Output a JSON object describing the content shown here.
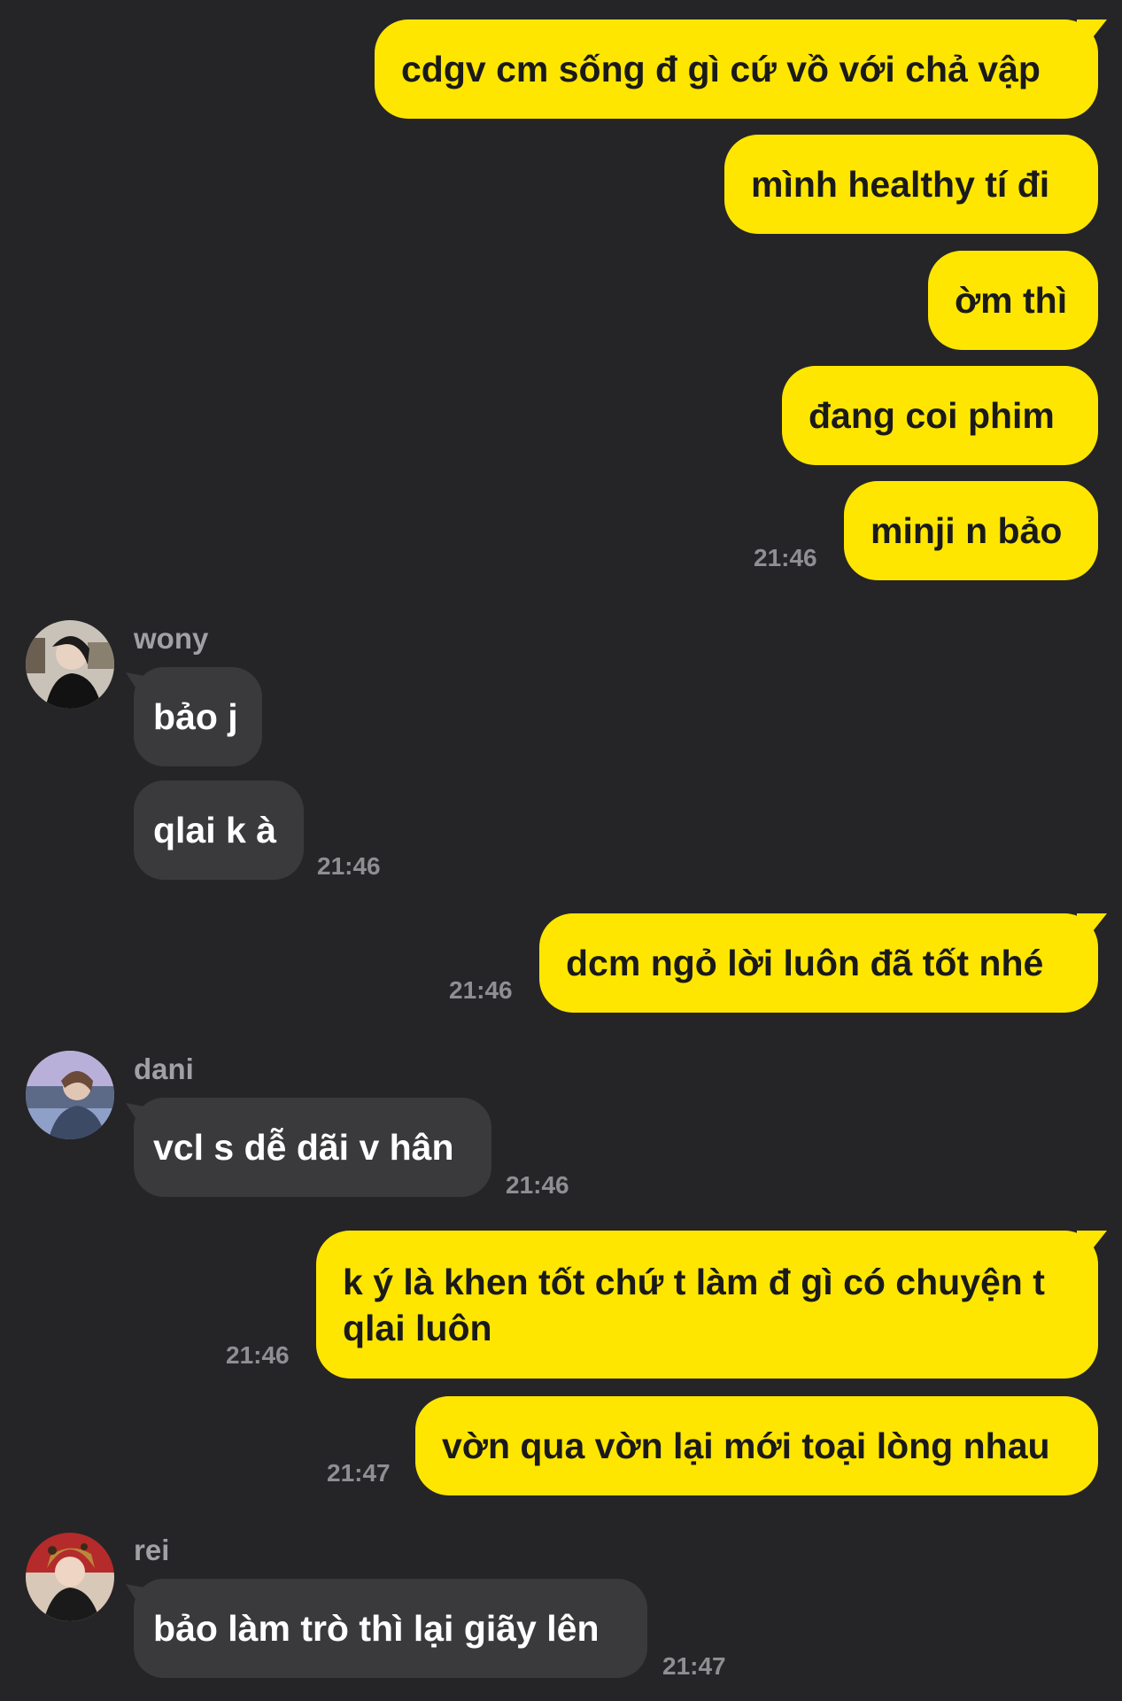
{
  "colors": {
    "background": "#252527",
    "outgoing_bubble": "#ffe600",
    "incoming_bubble": "#3a3a3c",
    "timestamp": "#8e8e93",
    "sender_name": "#a0a0a5"
  },
  "messages": {
    "m1": "cdgv cm sống đ gì cứ vồ với chả vập",
    "m2": "mình healthy tí đi",
    "m3": "ờm thì",
    "m4": "đang coi phim",
    "m5": "minji n bảo",
    "m5_time": "21:46",
    "wony_name": "wony",
    "m6": "bảo j",
    "m7": "qlai k à",
    "m7_time": "21:46",
    "m8": "dcm ngỏ lời luôn đã tốt nhé",
    "m8_time": "21:46",
    "dani_name": "dani",
    "m9": "vcl s dễ dãi v hân",
    "m9_time": "21:46",
    "m10": "k ý là khen tốt chứ t làm đ gì có chuyện t qlai luôn",
    "m10_time": "21:46",
    "m11": "vờn qua vờn lại mới toại lòng nhau",
    "m11_time": "21:47",
    "rei_name": "rei",
    "m12": "bảo làm trò thì lại giãy lên",
    "m12_time": "21:47"
  },
  "avatars": {
    "wony": "avatar-wony",
    "dani": "avatar-dani",
    "rei": "avatar-rei"
  }
}
